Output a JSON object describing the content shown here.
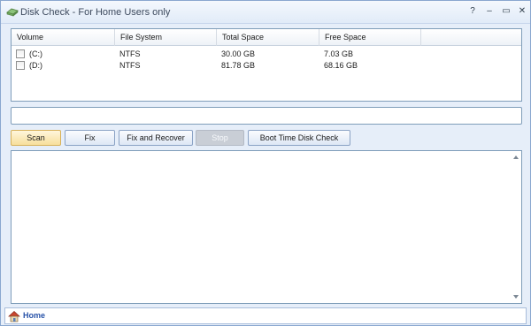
{
  "window": {
    "title": "Disk Check - For Home Users only",
    "help_glyph": "?",
    "minimize_glyph": "–",
    "maximize_glyph": "▭",
    "close_glyph": "✕",
    "icon": "disk-check-app-icon"
  },
  "volumes": {
    "columns": [
      "Volume",
      "File System",
      "Total Space",
      "Free Space",
      ""
    ],
    "rows": [
      {
        "volume": "(C:)",
        "file_system": "NTFS",
        "total_space": "30.00 GB",
        "free_space": "7.03 GB",
        "checked": false
      },
      {
        "volume": "(D:)",
        "file_system": "NTFS",
        "total_space": "81.78 GB",
        "free_space": "68.16 GB",
        "checked": false
      }
    ]
  },
  "status": {
    "value": ""
  },
  "buttons": {
    "scan": "Scan",
    "fix": "Fix",
    "fix_and_recover": "Fix and Recover",
    "stop": "Stop",
    "boot_time": "Boot Time Disk Check"
  },
  "log": {
    "text": ""
  },
  "nav": {
    "home_label": "Home",
    "home_icon": "house-icon"
  },
  "colors": {
    "accent": "#2752a8",
    "border": "#7f9db9",
    "window_bg": "#e6eef9",
    "active_button": "#f7df9c"
  }
}
